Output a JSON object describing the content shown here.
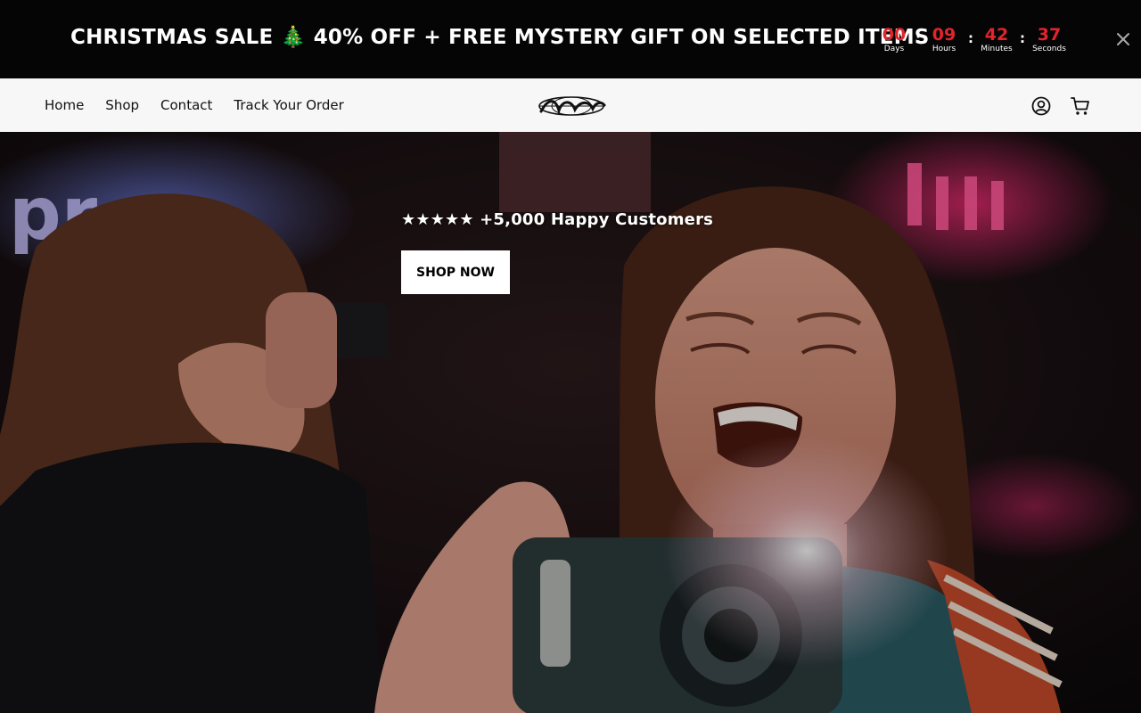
{
  "announcement": {
    "text": "CHRISTMAS SALE 🎄 40% OFF + FREE MYSTERY GIFT ON SELECTED ITEMS",
    "countdown": {
      "days": "00",
      "days_label": "Days",
      "hours": "09",
      "hours_label": "Hours",
      "minutes": "42",
      "minutes_label": "Minutes",
      "seconds": "37",
      "seconds_label": "Seconds",
      "separator": ":"
    },
    "close_icon": "close-icon"
  },
  "header": {
    "nav": [
      "Home",
      "Shop",
      "Contact",
      "Track Your Order"
    ],
    "logo_icon": "brand-logo",
    "account_icon": "user-icon",
    "cart_icon": "cart-icon"
  },
  "hero": {
    "tagline": "★★★★★ +5,000 Happy Customers",
    "cta_label": "SHOP NOW"
  },
  "colors": {
    "announcement_bg": "#050505",
    "countdown_number": "#e0252b",
    "header_bg": "#f7f7f7",
    "cta_bg": "#ffffff"
  }
}
